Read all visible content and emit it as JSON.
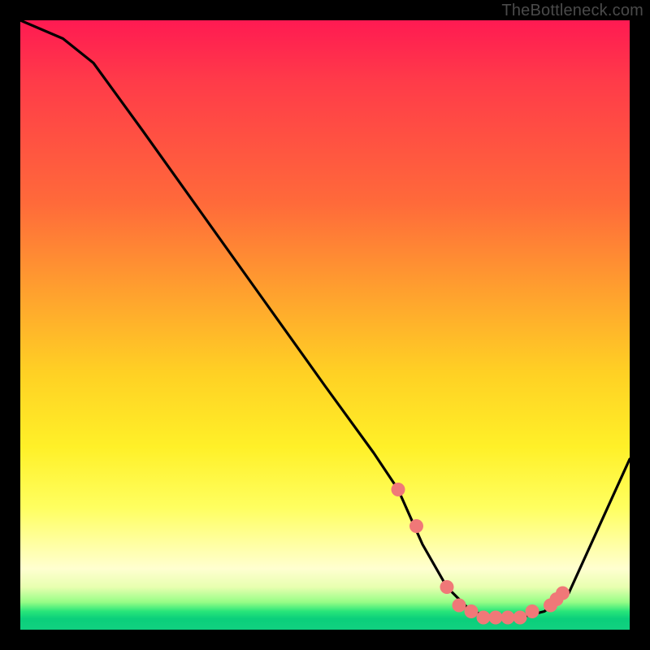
{
  "watermark": "TheBottleneck.com",
  "chart_data": {
    "type": "line",
    "title": "",
    "xlabel": "",
    "ylabel": "",
    "xlim": [
      0,
      100
    ],
    "ylim": [
      0,
      100
    ],
    "series": [
      {
        "name": "bottleneck-curve",
        "x": [
          0,
          7,
          12,
          20,
          30,
          40,
          50,
          58,
          62,
          66,
          70,
          74,
          78,
          82,
          86,
          90,
          100
        ],
        "values": [
          100,
          97,
          93,
          82,
          68,
          54,
          40,
          29,
          23,
          14,
          7,
          3,
          2,
          2,
          3,
          6,
          28
        ]
      }
    ],
    "markers": {
      "name": "highlight-dots",
      "color": "#f07878",
      "x": [
        62,
        65,
        70,
        72,
        74,
        76,
        78,
        80,
        82,
        84,
        87,
        88,
        89
      ],
      "values": [
        23,
        17,
        7,
        4,
        3,
        2,
        2,
        2,
        2,
        3,
        4,
        5,
        6
      ]
    },
    "background": {
      "type": "vertical-gradient",
      "stops": [
        {
          "pos": 0,
          "color": "#ff1a52"
        },
        {
          "pos": 45,
          "color": "#ffa22e"
        },
        {
          "pos": 70,
          "color": "#fff028"
        },
        {
          "pos": 93,
          "color": "#e8ffb0"
        },
        {
          "pos": 100,
          "color": "#11d080"
        }
      ]
    }
  }
}
